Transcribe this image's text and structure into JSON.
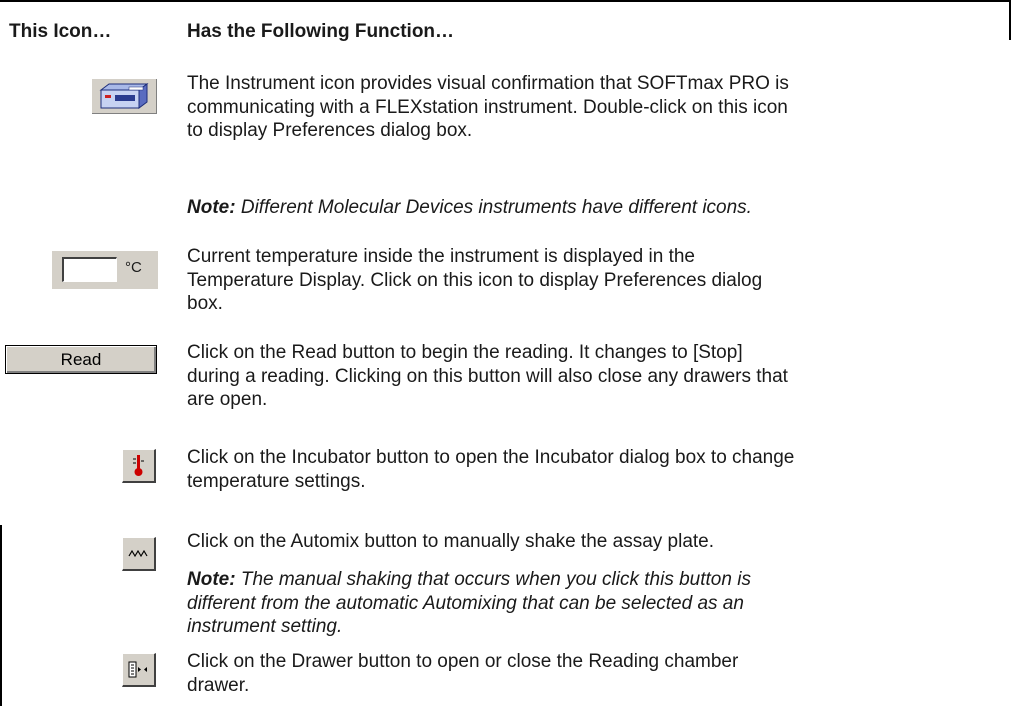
{
  "header": {
    "col_icon": "This Icon…",
    "col_function": "Has the Following Function…"
  },
  "rows": [
    {
      "icon": "instrument-icon",
      "lines": [
        "The Instrument icon provides visual confirmation that SOFTmax PRO is",
        "communicating with a FLEXstation instrument. Double-click on this icon",
        "to display Preferences dialog box."
      ],
      "note_label": "Note:",
      "note_text": " Different Molecular Devices instruments have different icons."
    },
    {
      "icon": "temperature-display-icon",
      "unit": "°C",
      "lines": [
        "Current temperature inside the instrument is displayed in the",
        "Temperature Display. Click on this icon to display Preferences dialog",
        "box."
      ]
    },
    {
      "icon": "read-button-icon",
      "button_label": "Read",
      "lines": [
        "Click on the Read button to begin the reading. It changes to [Stop]",
        "during a reading. Clicking on this button will also close any drawers that",
        "are open."
      ]
    },
    {
      "icon": "thermometer-icon",
      "lines": [
        "Click on the Incubator button to open the Incubator dialog box to change",
        "temperature settings."
      ]
    },
    {
      "icon": "zigzag-icon",
      "lines": [
        "Click on the Automix button to manually shake the assay plate."
      ],
      "note_label": "Note:",
      "note_lines": [
        " The manual shaking that occurs when you click this button is",
        "different from the automatic Automixing that can be selected as an",
        "instrument setting."
      ]
    },
    {
      "icon": "drawer-icon",
      "lines": [
        "Click on the Drawer button to open or close the Reading chamber",
        "drawer."
      ]
    }
  ],
  "colors": {
    "button_face": "#d4d0c8",
    "thermometer_red": "#cc0000"
  }
}
